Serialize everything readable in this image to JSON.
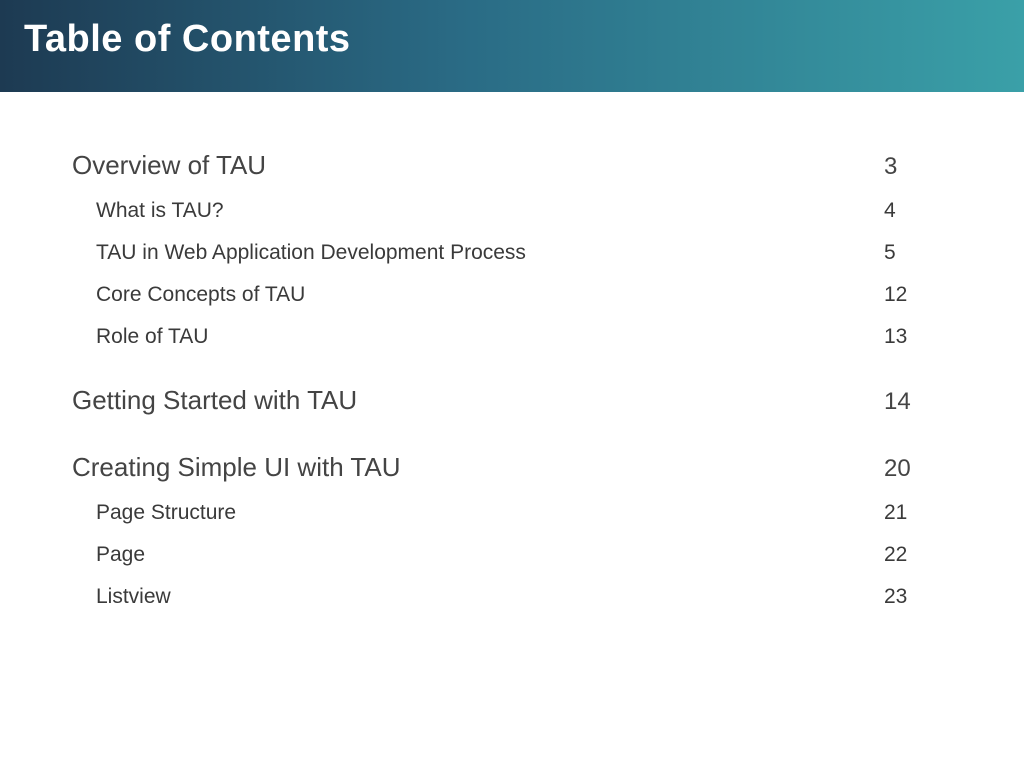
{
  "title": "Table of Contents",
  "sections": [
    {
      "label": "Overview of TAU",
      "page": "3",
      "items": [
        {
          "label": "What is TAU?",
          "page": "4"
        },
        {
          "label": "TAU in Web Application Development Process",
          "page": "5"
        },
        {
          "label": "Core Concepts of TAU",
          "page": "12"
        },
        {
          "label": "Role of TAU",
          "page": "13"
        }
      ]
    },
    {
      "label": "Getting Started with TAU",
      "page": "14",
      "items": []
    },
    {
      "label": "Creating Simple UI with TAU",
      "page": "20",
      "items": [
        {
          "label": "Page Structure",
          "page": "21"
        },
        {
          "label": "Page",
          "page": "22"
        },
        {
          "label": "Listview",
          "page": "23"
        }
      ]
    }
  ]
}
